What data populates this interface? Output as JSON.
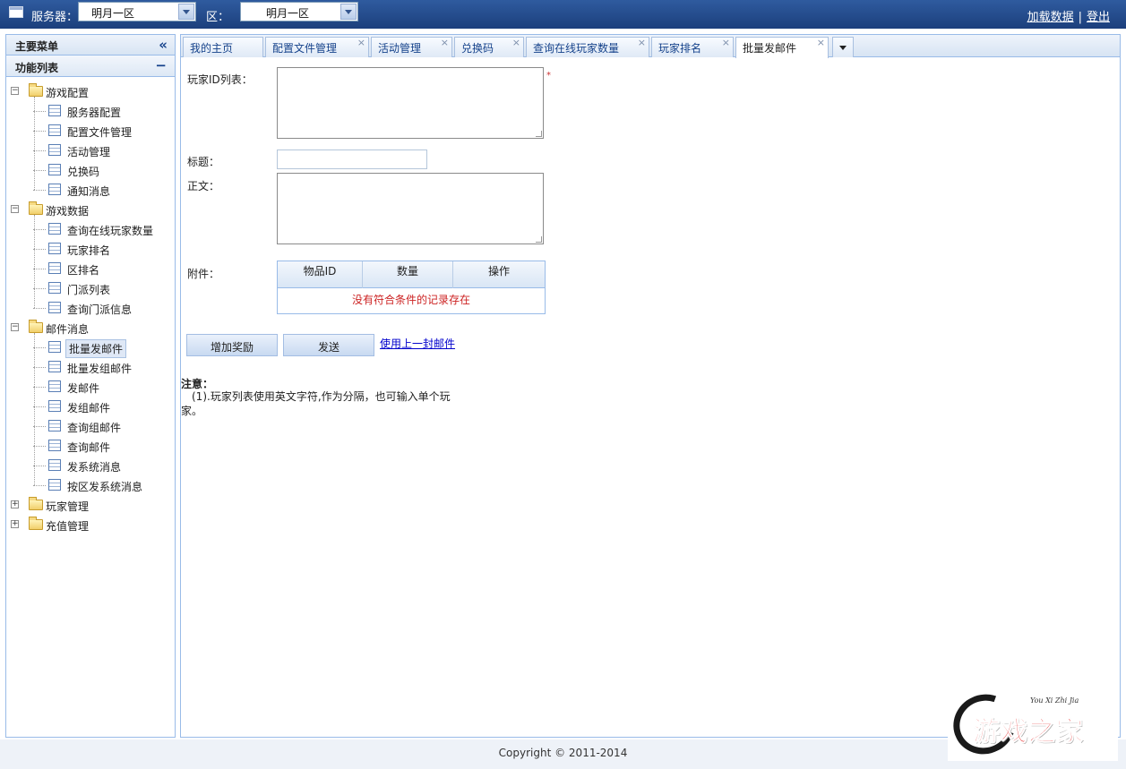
{
  "topbar": {
    "server_label": "服务器：",
    "server_value": "明月一区",
    "zone_label": "区：",
    "zone_value": "明月一区",
    "reload_link": "加载数据",
    "separator": "|",
    "logout_link": "登出"
  },
  "sidebar": {
    "main_menu_title": "主要菜单",
    "collapse_glyph": "«",
    "function_list_title": "功能列表",
    "minus_glyph": "−",
    "groups": [
      {
        "label": "游戏配置",
        "expanded": true,
        "items": [
          "服务器配置",
          "配置文件管理",
          "活动管理",
          "兑换码",
          "通知消息"
        ]
      },
      {
        "label": "游戏数据",
        "expanded": true,
        "items": [
          "查询在线玩家数量",
          "玩家排名",
          "区排名",
          "门派列表",
          "查询门派信息"
        ]
      },
      {
        "label": "邮件消息",
        "expanded": true,
        "items": [
          "批量发邮件",
          "批量发组邮件",
          "发邮件",
          "发组邮件",
          "查询组邮件",
          "查询邮件",
          "发系统消息",
          "按区发系统消息"
        ]
      },
      {
        "label": "玩家管理",
        "expanded": false,
        "items": []
      },
      {
        "label": "充值管理",
        "expanded": false,
        "items": []
      }
    ],
    "selected_item": "批量发邮件"
  },
  "tabs": [
    {
      "label": "我的主页",
      "closable": false,
      "active": false
    },
    {
      "label": "配置文件管理",
      "closable": true,
      "active": false
    },
    {
      "label": "活动管理",
      "closable": true,
      "active": false
    },
    {
      "label": "兑换码",
      "closable": true,
      "active": false
    },
    {
      "label": "查询在线玩家数量",
      "closable": true,
      "active": false
    },
    {
      "label": "玩家排名",
      "closable": true,
      "active": false
    },
    {
      "label": "批量发邮件",
      "closable": true,
      "active": true
    }
  ],
  "tab_close_glyph": "×",
  "form": {
    "player_ids_label": "玩家ID列表：",
    "required_mark": "*",
    "title_label": "标题：",
    "body_label": "正文：",
    "attachment_label": "附件：",
    "grid_columns": [
      "物品ID",
      "数量",
      "操作"
    ],
    "grid_empty": "没有符合条件的记录存在",
    "add_reward_button": "增加奖励",
    "send_button": "发送",
    "use_last_mail_link": "使用上一封邮件"
  },
  "note": {
    "title": "注意：",
    "text": "　(1).玩家列表使用英文字符,作为分隔，也可输入单个玩家。"
  },
  "footer": {
    "copyright": "Copyright © 2011-2014"
  },
  "watermark": {
    "subtitle": "You Xi Zhi Jia",
    "title": "游戏之家"
  },
  "colors": {
    "topbar": "#1c3f7c",
    "panel_border": "#99bbe8",
    "error_text": "#cc2222",
    "link": "#0000cc"
  }
}
